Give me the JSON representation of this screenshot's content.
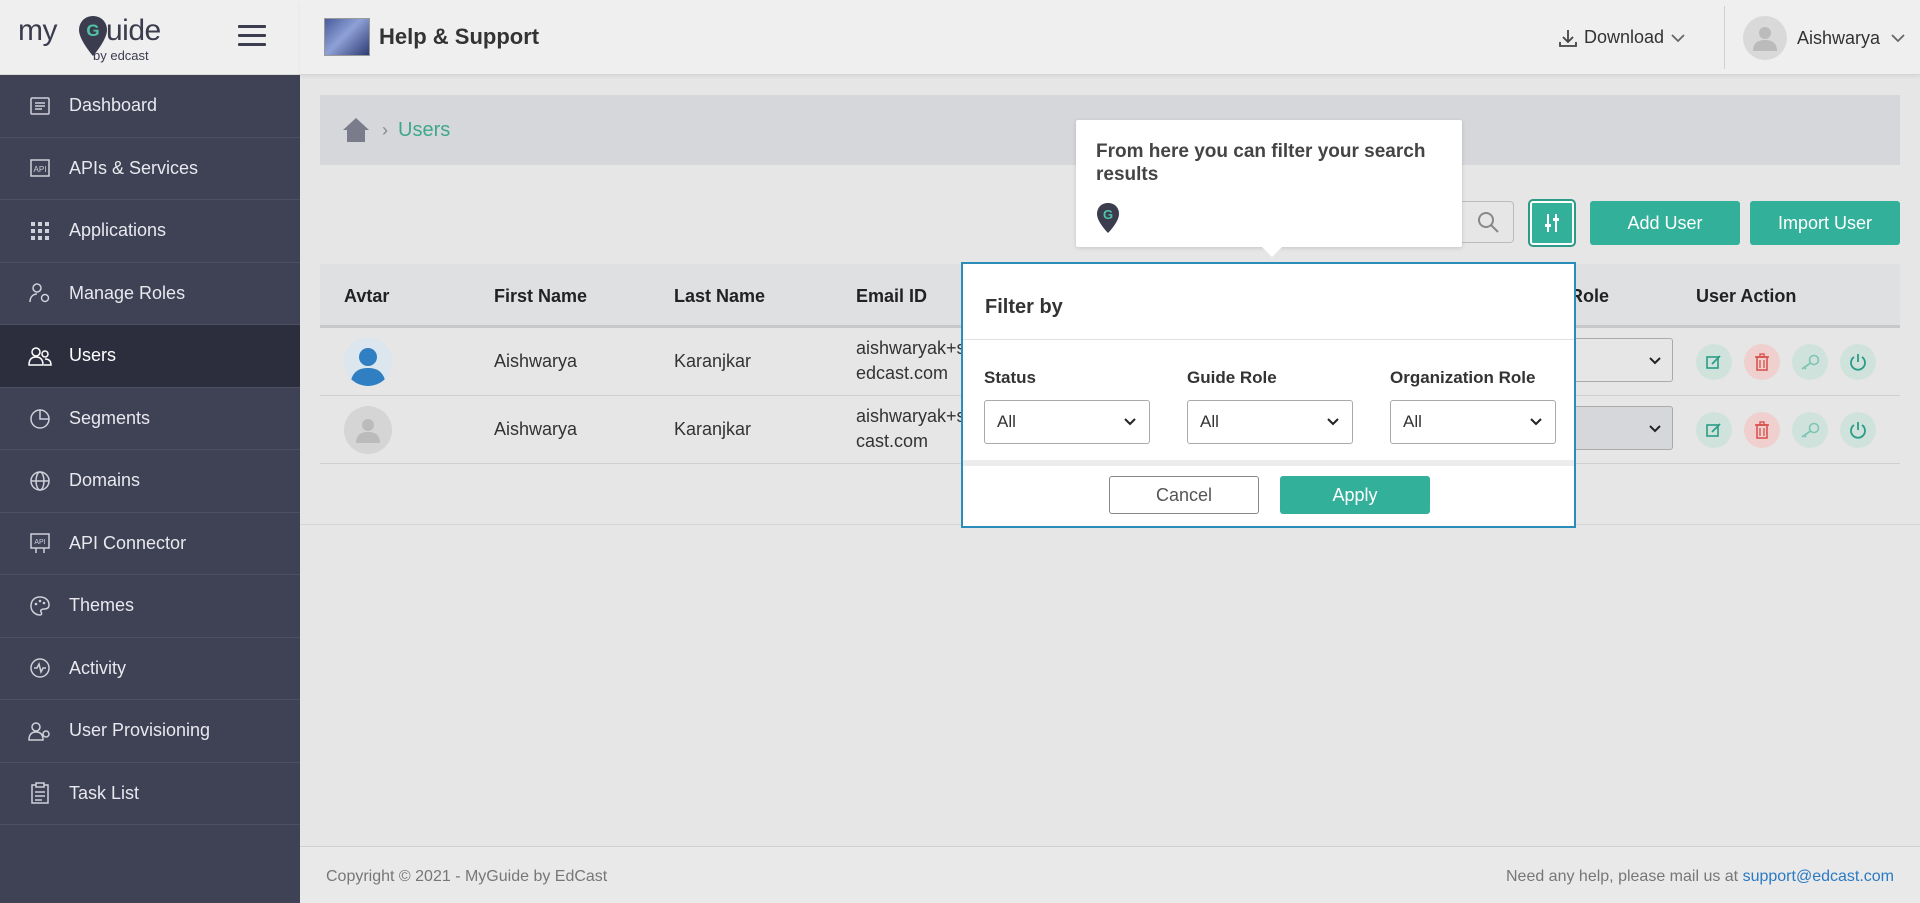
{
  "brand": {
    "logo_my": "my",
    "logo_guide": "uide",
    "logo_by": "by edcast"
  },
  "sidebar": {
    "items": [
      {
        "label": "Dashboard",
        "icon": "dashboard-icon"
      },
      {
        "label": "APIs & Services",
        "icon": "api-icon"
      },
      {
        "label": "Applications",
        "icon": "grid-icon"
      },
      {
        "label": "Manage Roles",
        "icon": "user-gear-icon"
      },
      {
        "label": "Users",
        "icon": "users-icon",
        "active": true
      },
      {
        "label": "Segments",
        "icon": "pie-chart-icon"
      },
      {
        "label": "Domains",
        "icon": "globe-icon"
      },
      {
        "label": "API Connector",
        "icon": "api-connector-icon"
      },
      {
        "label": "Themes",
        "icon": "palette-icon"
      },
      {
        "label": "Activity",
        "icon": "activity-icon"
      },
      {
        "label": "User Provisioning",
        "icon": "user-provisioning-icon"
      },
      {
        "label": "Task List",
        "icon": "clipboard-icon"
      }
    ]
  },
  "header": {
    "app_title": "Help & Support",
    "download_label": "Download",
    "user_name": "Aishwarya"
  },
  "breadcrumb": {
    "current": "Users"
  },
  "toolbar": {
    "add_user_label": "Add User",
    "import_user_label": "Import User"
  },
  "table": {
    "columns": [
      "Avtar",
      "First Name",
      "Last Name",
      "Email ID",
      "Role",
      "User Action"
    ],
    "rows": [
      {
        "first_name": "Aishwarya",
        "last_name": "Karanjkar",
        "email_line1": "aishwaryak+s",
        "email_line2": "edcast.com"
      },
      {
        "first_name": "Aishwarya",
        "last_name": "Karanjkar",
        "email_line1": "aishwaryak+s",
        "email_line2": "cast.com"
      }
    ]
  },
  "filter_dialog": {
    "title": "Filter by",
    "status_label": "Status",
    "status_value": "All",
    "guide_role_label": "Guide Role",
    "guide_role_value": "All",
    "org_role_label": "Organization Role",
    "org_role_value": "All",
    "cancel_label": "Cancel",
    "apply_label": "Apply"
  },
  "tooltip": {
    "text": "From here you can filter your search results"
  },
  "footer": {
    "copyright": "Copyright © 2021 - MyGuide by EdCast",
    "help_text": "Need any help, please mail us at ",
    "help_email": "support@edcast.com"
  },
  "colors": {
    "accent": "#33b09a",
    "sidebar": "#3f4155",
    "dialog_border": "#2a8cb8",
    "link": "#2a7ac4"
  }
}
